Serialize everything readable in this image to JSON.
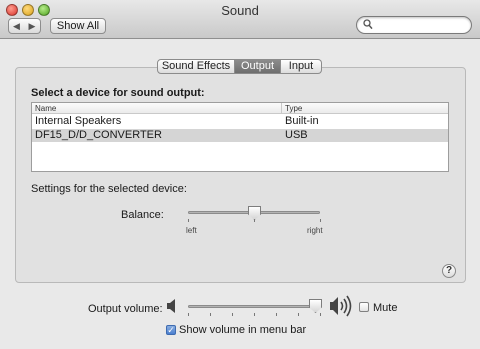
{
  "window": {
    "title": "Sound"
  },
  "toolbar": {
    "back_glyph": "◀",
    "forward_glyph": "▶",
    "show_all": "Show All",
    "search_placeholder": "",
    "search_value": ""
  },
  "tabs": [
    {
      "label": "Sound Effects",
      "active": false
    },
    {
      "label": "Output",
      "active": true
    },
    {
      "label": "Input",
      "active": false
    }
  ],
  "output": {
    "select_label": "Select a device for sound output:",
    "columns": [
      "Name",
      "Type"
    ],
    "devices": [
      {
        "name": "Internal Speakers",
        "type": "Built-in",
        "selected": false
      },
      {
        "name": "DF15_D/D_CONVERTER",
        "type": "USB",
        "selected": true
      }
    ],
    "settings_label": "Settings for the selected device:",
    "balance": {
      "label": "Balance:",
      "left": "left",
      "right": "right",
      "value": 0.5
    }
  },
  "help_glyph": "?",
  "volume": {
    "label": "Output volume:",
    "value": 0.97,
    "mute_label": "Mute",
    "mute_checked": false,
    "menubar_label": "Show volume in menu bar",
    "menubar_checked": true,
    "check_glyph": "✓"
  },
  "icons": {
    "search": "search-icon",
    "speaker_low": "speaker-low-icon",
    "speaker_high": "speaker-high-icon",
    "help": "help-icon"
  },
  "colors": {
    "selected_tab": "#7c7c7c",
    "selected_row": "#d5d5d5",
    "checkbox_checked": "#4b7fd0"
  }
}
